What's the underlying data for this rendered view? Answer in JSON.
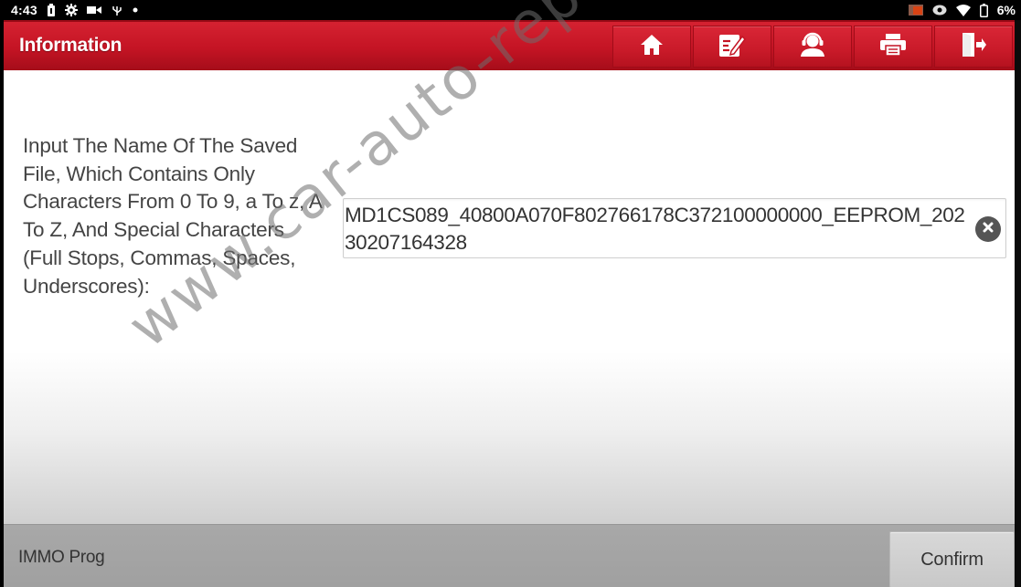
{
  "status_bar": {
    "time": "4:43",
    "left_icons": [
      "battery-saver-icon",
      "settings-gear-icon",
      "video-camera-icon",
      "usb-debug-icon",
      "notification-dot-icon"
    ],
    "right_icons": [
      "cast-icon",
      "eye-icon",
      "wifi-icon",
      "battery-icon"
    ],
    "battery_percent": "6%"
  },
  "header": {
    "title": "Information",
    "title_bg_color": "#c41424",
    "toolbar": [
      {
        "name": "home",
        "icon": "home-icon"
      },
      {
        "name": "edit-report",
        "icon": "edit-note-icon"
      },
      {
        "name": "remote-support",
        "icon": "support-agent-icon"
      },
      {
        "name": "print",
        "icon": "printer-icon"
      },
      {
        "name": "exit",
        "icon": "exit-door-icon"
      }
    ]
  },
  "main": {
    "prompt": "Input The Name Of The Saved File, Which Contains Only Characters From 0 To 9, a To z, A To Z, And Special Characters (Full Stops, Commas, Spaces, Underscores):",
    "filename_input": {
      "value": "MD1CS089_40800A070F802766178C372100000000_EEPROM_20230207164328",
      "clear_icon": "clear-circle-icon"
    }
  },
  "footer": {
    "label": "IMMO Prog",
    "confirm_label": "Confirm"
  },
  "watermark": "www.car-auto-repair.com"
}
